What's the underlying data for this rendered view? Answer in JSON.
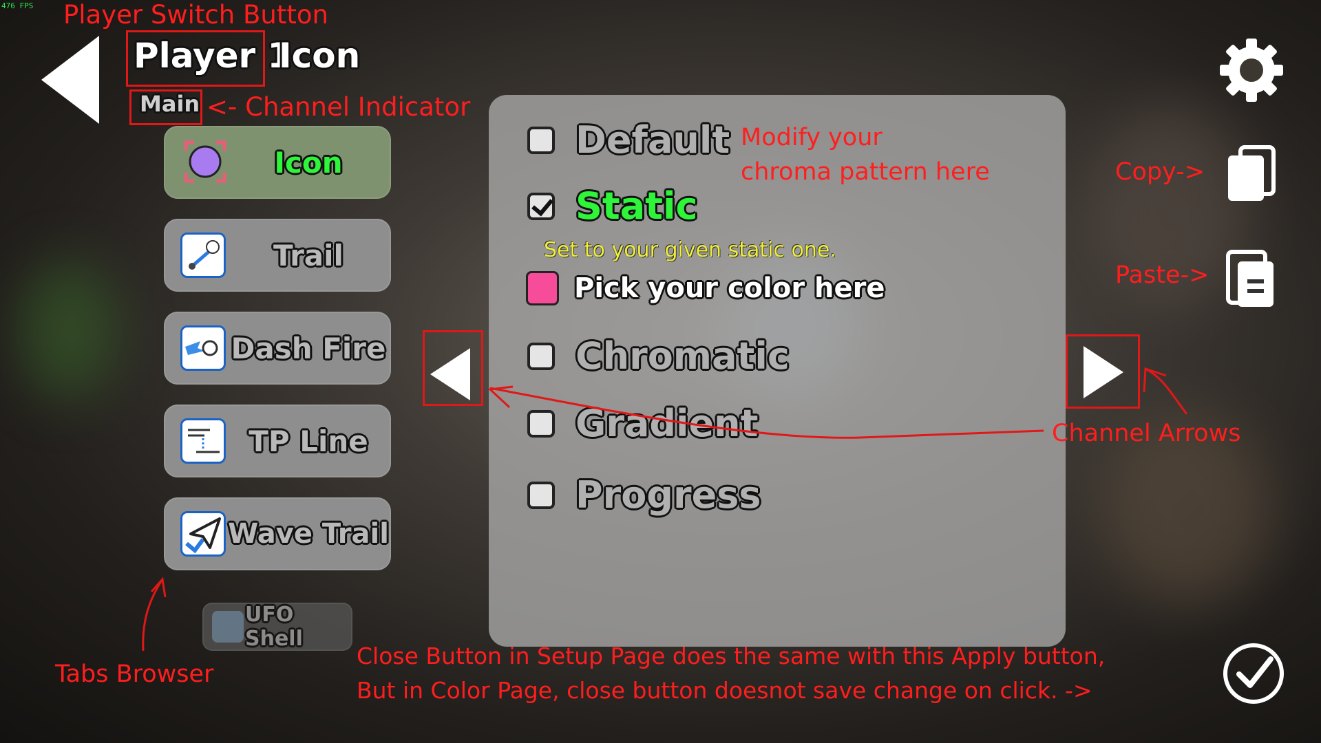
{
  "fps": "476 FPS",
  "header": {
    "player": "Player 1",
    "page": "Icon",
    "channel": "Main"
  },
  "tabs": [
    {
      "label": "Icon",
      "icon": "icon-cube-icon",
      "active": true
    },
    {
      "label": "Trail",
      "icon": "trail-icon",
      "active": false
    },
    {
      "label": "Dash Fire",
      "icon": "dash-fire-icon",
      "active": false
    },
    {
      "label": "TP Line",
      "icon": "tp-line-icon",
      "active": false
    },
    {
      "label": "Wave Trail",
      "icon": "wave-trail-icon",
      "active": false
    },
    {
      "label": "UFO Shell",
      "icon": "ufo-shell-icon",
      "active": false,
      "disabled": true
    }
  ],
  "options": {
    "default": "Default",
    "static": "Static",
    "static_hint": "Set to your given static one.",
    "pick_color": "Pick your color here",
    "chromatic": "Chromatic",
    "gradient": "Gradient",
    "progress": "Progress"
  },
  "selected_color": "#f74c9a",
  "annotations": {
    "player_switch": "Player Switch Button",
    "channel_indicator": "<- Channel Indicator",
    "modify_1": "Modify your",
    "modify_2": "chroma pattern here",
    "copy": "Copy->",
    "paste": "Paste->",
    "channel_arrows": "Channel Arrows",
    "tabs_browser": "Tabs Browser",
    "close_1": "Close Button in Setup Page does the same with this Apply button,",
    "close_2": "But in Color Page, close button doesnot save change on click. ->"
  }
}
